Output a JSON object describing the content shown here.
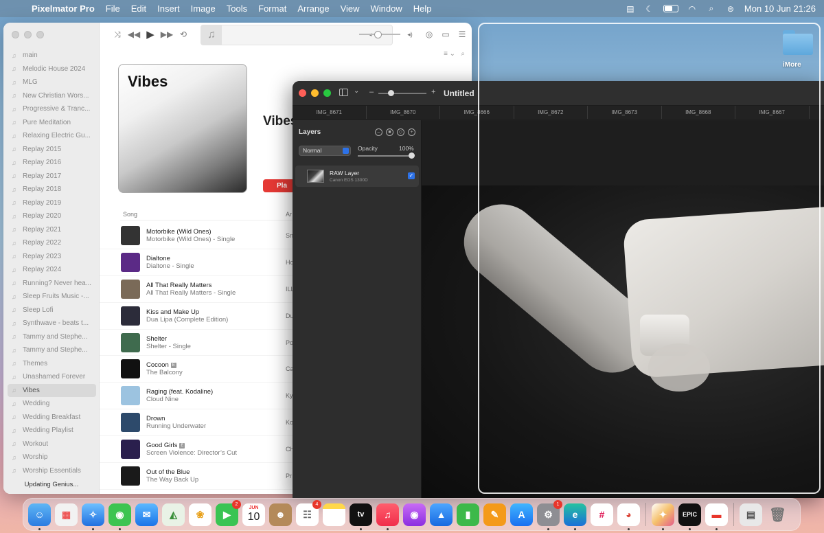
{
  "menubar": {
    "app_name": "Pixelmator Pro",
    "menus": [
      "File",
      "Edit",
      "Insert",
      "Image",
      "Tools",
      "Format",
      "Arrange",
      "View",
      "Window",
      "Help"
    ],
    "clock": "Mon 10 Jun  21:26"
  },
  "music": {
    "playlists": [
      "main",
      "Melodic House 2024",
      "MLG",
      "New Christian Wors...",
      "Progressive & Tranc...",
      "Pure Meditation",
      "Relaxing Electric Gu...",
      "Replay 2015",
      "Replay 2016",
      "Replay 2017",
      "Replay 2018",
      "Replay 2019",
      "Replay 2020",
      "Replay 2021",
      "Replay 2022",
      "Replay 2023",
      "Replay 2024",
      "Running? Never hea...",
      "Sleep Fruits Music -...",
      "Sleep Lofi",
      "Synthwave - beats t...",
      "Tammy and Stephe...",
      "Tammy and Stephe...",
      "Themes",
      "Unashamed Forever",
      "Vibes",
      "Wedding",
      "Wedding Breakfast",
      "Wedding Playlist",
      "Workout",
      "Worship",
      "Worship Essentials"
    ],
    "active_playlist_index": 25,
    "genius_status": "Updating Genius...",
    "album_art_title": "Vibes",
    "playlist_title": "Vibes",
    "play_label": "Pla",
    "song_column": "Song",
    "artist_column": "Ar",
    "songs": [
      {
        "title": "Motorbike (Wild Ones)",
        "album": "Motorbike (Wild Ones) - Single",
        "artist": "Sn",
        "explicit": false,
        "color": "#333333"
      },
      {
        "title": "Dialtone",
        "album": "Dialtone - Single",
        "artist": "Ho",
        "explicit": false,
        "color": "#5b2a86"
      },
      {
        "title": "All That Really Matters",
        "album": "All That Really Matters - Single",
        "artist": "ILL",
        "explicit": false,
        "color": "#7a6a58"
      },
      {
        "title": "Kiss and Make Up",
        "album": "Dua Lipa (Complete Edition)",
        "artist": "Du",
        "explicit": false,
        "color": "#2c2c3a"
      },
      {
        "title": "Shelter",
        "album": "Shelter - Single",
        "artist": "Po",
        "explicit": false,
        "color": "#3f6b4e"
      },
      {
        "title": "Cocoon",
        "album": "The Balcony",
        "artist": "Ca",
        "explicit": true,
        "color": "#111111"
      },
      {
        "title": "Raging (feat. Kodaline)",
        "album": "Cloud Nine",
        "artist": "Ky",
        "explicit": false,
        "color": "#9cc3e0"
      },
      {
        "title": "Drown",
        "album": "Running Underwater",
        "artist": "Ko",
        "explicit": false,
        "color": "#2d4a6b"
      },
      {
        "title": "Good Girls",
        "album": "Screen Violence: Director’s Cut",
        "artist": "Ch",
        "explicit": true,
        "color": "#2a1f4d"
      },
      {
        "title": "Out of the Blue",
        "album": "The Way Back Up",
        "artist": "Pr",
        "explicit": false,
        "color": "#1a1a1a"
      }
    ]
  },
  "desktop": {
    "folder_label": "iMore"
  },
  "pixelmator": {
    "title": "Untitled",
    "tabs": [
      "IMG_8671",
      "IMG_8670",
      "IMG_8666",
      "IMG_8672",
      "IMG_8673",
      "IMG_8668",
      "IMG_8667"
    ],
    "layers_title": "Layers",
    "blend_mode": "Normal",
    "opacity_label": "Opacity",
    "opacity_value": "100%",
    "opacity_fraction": 1.0,
    "layer_name": "RAW Layer",
    "layer_camera": "Canon EOS 1300D"
  },
  "dock": {
    "calendar_month": "JUN",
    "calendar_day": "10",
    "facetime_badge": "2",
    "reminders_badge": "4",
    "settings_badge": "1",
    "tv_label": "tv",
    "epic_label": "EPIC"
  },
  "colors": {
    "accent_blue": "#2d72e8",
    "play_red": "#e53935"
  }
}
